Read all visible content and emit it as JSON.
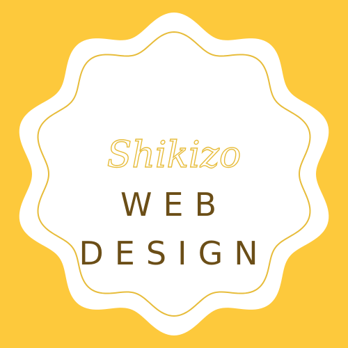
{
  "logo": {
    "script_word": "Shikizo",
    "line_1": "WEB",
    "line_2": "DESIGN"
  },
  "colors": {
    "background": "#FDC93C",
    "badge": "#FFFFFF",
    "outline": "#E7BC3A",
    "script_text": "#E7BC3A",
    "block_text": "#6B4E17"
  }
}
